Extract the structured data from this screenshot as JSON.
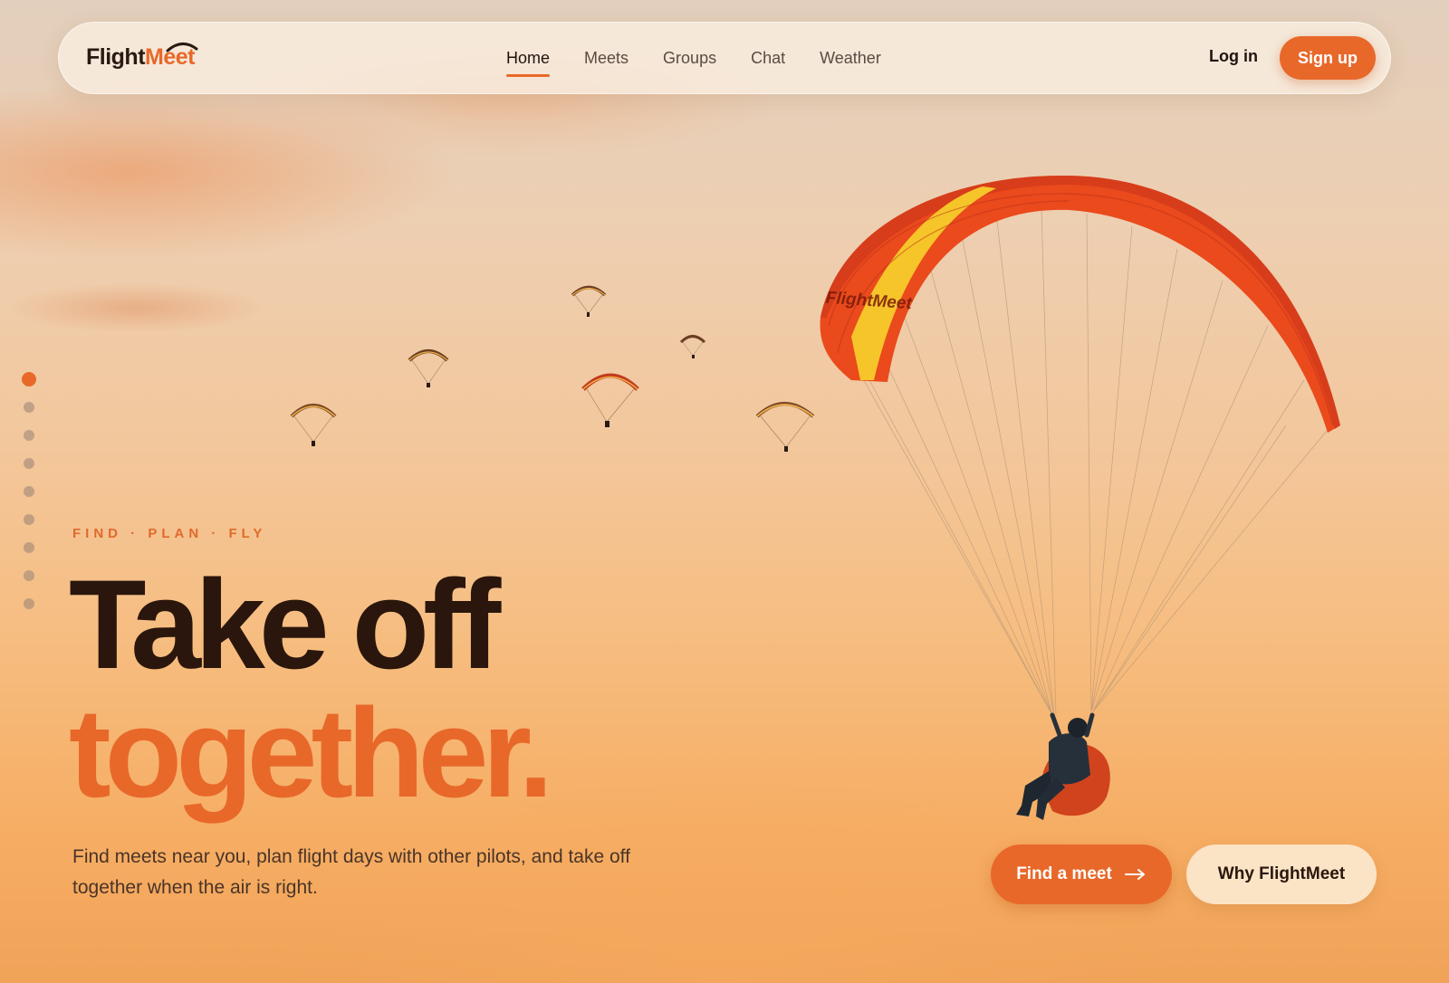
{
  "brand": {
    "part1": "Flight",
    "part2": "Meet",
    "accent": "#e8682a"
  },
  "nav": {
    "items": [
      {
        "label": "Home",
        "active": true
      },
      {
        "label": "Meets"
      },
      {
        "label": "Groups"
      },
      {
        "label": "Chat"
      },
      {
        "label": "Weather"
      }
    ],
    "login": "Log in",
    "signup": "Sign up"
  },
  "slides": {
    "count": 9,
    "active": 1
  },
  "hero": {
    "eyebrow": "FIND · PLAN · FLY",
    "title_line1": "Take off",
    "title_line2": "together.",
    "lead": "Find meets near you, plan flight days with other pilots, and take off together when the air is right.",
    "canopy_text": "FlightMeet",
    "cta_primary": "Find a meet",
    "cta_primary_icon": "arrow-right-icon",
    "cta_secondary": "Why FlightMeet"
  }
}
